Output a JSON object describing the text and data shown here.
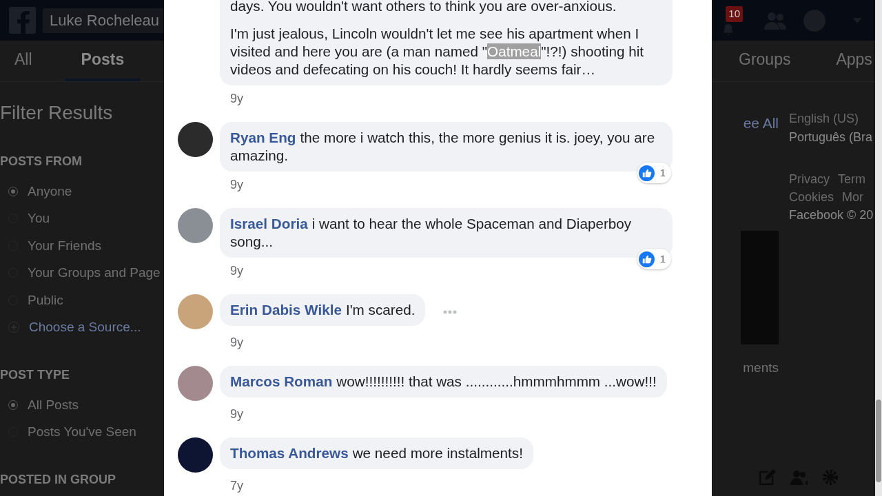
{
  "background": {
    "top_bar": {
      "search_value": "Luke Rocheleau",
      "notification_count": "10"
    },
    "tabs": [
      {
        "label": "All",
        "selected": false
      },
      {
        "label": "Posts",
        "selected": true
      },
      {
        "label": "Groups",
        "selected": false
      },
      {
        "label": "Apps",
        "selected": false
      }
    ],
    "filter": {
      "title": "Filter Results",
      "sections": [
        {
          "heading": "POSTS FROM",
          "options": [
            {
              "label": "Anyone",
              "selected": true,
              "kind": "radio"
            },
            {
              "label": "You",
              "selected": false,
              "kind": "radio"
            },
            {
              "label": "Your Friends",
              "selected": false,
              "kind": "radio"
            },
            {
              "label": "Your Groups and Page",
              "selected": false,
              "kind": "radio"
            },
            {
              "label": "Public",
              "selected": false,
              "kind": "radio"
            },
            {
              "label": "Choose a Source...",
              "selected": false,
              "kind": "add"
            }
          ]
        },
        {
          "heading": "POST TYPE",
          "options": [
            {
              "label": "All Posts",
              "selected": true,
              "kind": "radio"
            },
            {
              "label": "Posts You've Seen",
              "selected": false,
              "kind": "radio"
            }
          ]
        },
        {
          "heading": "POSTED IN GROUP"
        }
      ]
    },
    "see_all": "ee All",
    "video_caption": "ments",
    "languages": [
      {
        "label": "English (US)",
        "current": true
      },
      {
        "label": "Português (Bra",
        "current": false
      }
    ],
    "footer_links": [
      [
        "Privacy",
        "Term"
      ],
      [
        "Cookies",
        "Mor"
      ]
    ],
    "copyright": "Facebook © 20"
  },
  "comments": [
    {
      "paragraphs": [
        [
          {
            "text": "days. You wouldn't want others to think you are over-anxious.",
            "selected": false
          }
        ],
        [
          {
            "text": "I'm just jealous, Lincoln wouldn't let me see his apartment when I visited and here you are (a man named \"",
            "selected": false
          },
          {
            "text": "Oatmeal",
            "selected": true
          },
          {
            "text": "\"!?!) shooting hit videos and defecating on his couch! It hardly seems fair…",
            "selected": false
          }
        ]
      ],
      "time": "9y",
      "show_options": false
    },
    {
      "author": "Ryan Eng",
      "paragraphs": [
        [
          {
            "text": "the more i watch this, the more genius it is. joey, you are amazing.",
            "selected": false
          }
        ]
      ],
      "time": "9y",
      "likes": "1",
      "show_options": false
    },
    {
      "author": "Israel Doria",
      "paragraphs": [
        [
          {
            "text": "i want to hear the whole Spaceman and Diaperboy song...",
            "selected": false
          }
        ]
      ],
      "time": "9y",
      "likes": "1",
      "show_options": false
    },
    {
      "author": "Erin Dabis Wikle",
      "paragraphs": [
        [
          {
            "text": "I'm scared.",
            "selected": false
          }
        ]
      ],
      "time": "9y",
      "show_options": true
    },
    {
      "author": "Marcos Roman",
      "paragraphs": [
        [
          {
            "text": "wow!!!!!!!!!! that was ............hmmmhmmm ...wow!!!",
            "selected": false
          }
        ]
      ],
      "time": "9y",
      "show_options": false
    },
    {
      "author": "Thomas Andrews",
      "paragraphs": [
        [
          {
            "text": "we need more instalments!",
            "selected": false
          }
        ]
      ],
      "time": "7y",
      "show_options": false
    }
  ]
}
